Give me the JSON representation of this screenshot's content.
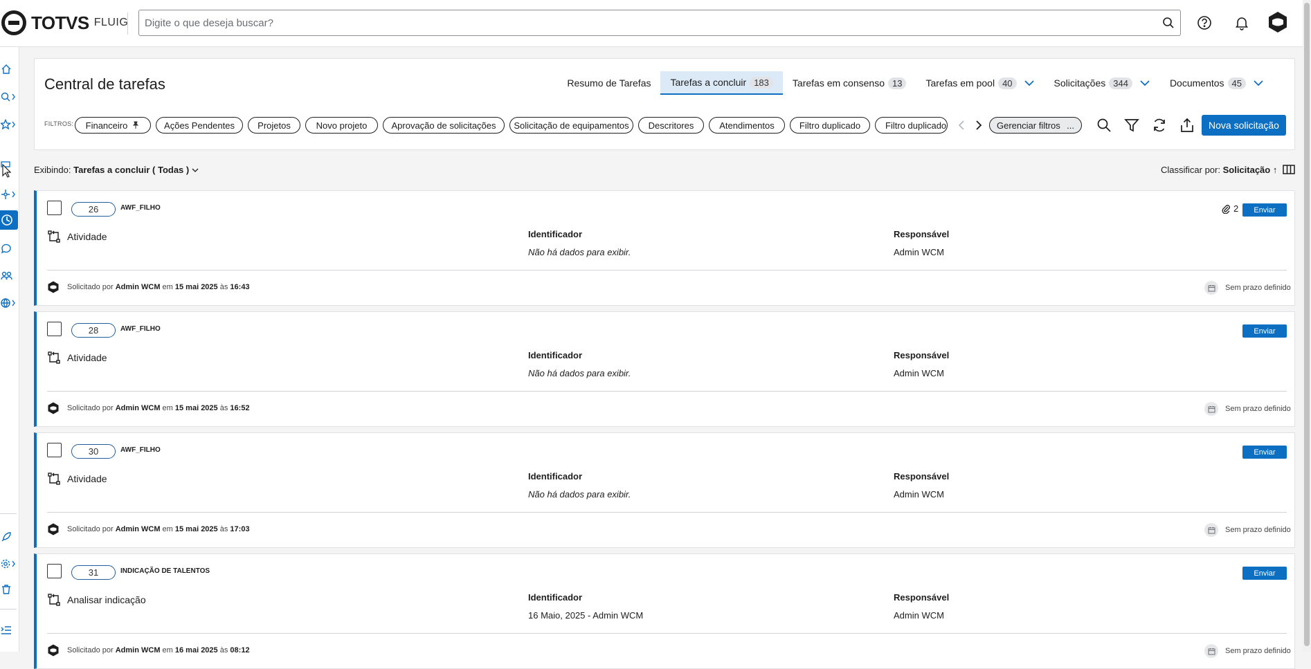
{
  "app": {
    "brand": "TOTVS",
    "product": "FLUIG"
  },
  "search": {
    "placeholder": "Digite o que deseja buscar?"
  },
  "topbar_icons": [
    "search-icon",
    "help-icon",
    "bell-icon",
    "user-avatar"
  ],
  "sidebar": {
    "items": [
      {
        "name": "home-icon"
      },
      {
        "name": "search-icon"
      },
      {
        "name": "star-icon"
      },
      {
        "name": "cursor-icon"
      },
      {
        "name": "workflow-icon"
      },
      {
        "name": "tasks-icon",
        "active": true
      },
      {
        "name": "chat-icon"
      },
      {
        "name": "people-icon"
      },
      {
        "name": "globe-icon"
      },
      {
        "name": "rocket-icon"
      },
      {
        "name": "gear-icon"
      },
      {
        "name": "trash-icon"
      },
      {
        "name": "collapse-menu-icon"
      }
    ]
  },
  "page": {
    "title": "Central de tarefas"
  },
  "tabs": [
    {
      "label": "Resumo de Tarefas",
      "count": "",
      "active": false,
      "dropdown": false
    },
    {
      "label": "Tarefas a concluir",
      "count": "183",
      "active": true,
      "dropdown": false
    },
    {
      "label": "Tarefas em consenso",
      "count": "13",
      "active": false,
      "dropdown": false
    },
    {
      "label": "Tarefas em pool",
      "count": "40",
      "active": false,
      "dropdown": true
    },
    {
      "label": "Solicitações",
      "count": "344",
      "active": false,
      "dropdown": true
    },
    {
      "label": "Documentos",
      "count": "45",
      "active": false,
      "dropdown": true
    }
  ],
  "filters": {
    "label": "FILTROS:",
    "chips": [
      "Financeiro",
      "Ações Pendentes",
      "Projetos",
      "Novo projeto",
      "Aprovação de solicitações",
      "Solicitação de equipamentos",
      "Descritores",
      "Atendimentos",
      "Filtro duplicado",
      "Filtro duplicado -"
    ],
    "manage_label": "Gerenciar filtros",
    "manage_more": "...",
    "new_request": "Nova solicitação"
  },
  "listing": {
    "showing_label": "Exibindo:",
    "showing_value": "Tarefas a concluir ( Todas )",
    "sort_label": "Classificar por:",
    "sort_value": "Solicitação ↑"
  },
  "columns": {
    "identifier": "Identificador",
    "responsible": "Responsável"
  },
  "tasks": [
    {
      "number": "26",
      "process": "AWF_FILHO",
      "attachments": "2",
      "send": "Enviar",
      "activity": "Atividade",
      "identifier": "Não há dados para exibir.",
      "responsible": "Admin WCM",
      "requested_prefix": "Solicitado por",
      "requested_by": "Admin WCM",
      "on": "em",
      "date": "15 mai 2025",
      "at": "às",
      "time": "16:43",
      "deadline": "Sem prazo definido"
    },
    {
      "number": "28",
      "process": "AWF_FILHO",
      "attachments": "",
      "send": "Enviar",
      "activity": "Atividade",
      "identifier": "Não há dados para exibir.",
      "responsible": "Admin WCM",
      "requested_prefix": "Solicitado por",
      "requested_by": "Admin WCM",
      "on": "em",
      "date": "15 mai 2025",
      "at": "às",
      "time": "16:52",
      "deadline": "Sem prazo definido"
    },
    {
      "number": "30",
      "process": "AWF_FILHO",
      "attachments": "",
      "send": "Enviar",
      "activity": "Atividade",
      "identifier": "Não há dados para exibir.",
      "responsible": "Admin WCM",
      "requested_prefix": "Solicitado por",
      "requested_by": "Admin WCM",
      "on": "em",
      "date": "15 mai 2025",
      "at": "às",
      "time": "17:03",
      "deadline": "Sem prazo definido"
    },
    {
      "number": "31",
      "process": "INDICAÇÃO DE TALENTOS",
      "attachments": "",
      "send": "Enviar",
      "activity": "Analisar indicação",
      "identifier": "16 Maio, 2025 - Admin WCM",
      "responsible": "Admin WCM",
      "requested_prefix": "Solicitado por",
      "requested_by": "Admin WCM",
      "on": "em",
      "date": "16 mai 2025",
      "at": "às",
      "time": "08:12",
      "deadline": "Sem prazo definido"
    }
  ],
  "colors": {
    "primary": "#0c6fc2",
    "tab_active_bg": "#dce9f7",
    "text": "#1d1d1d",
    "border": "#dfe1e4"
  }
}
